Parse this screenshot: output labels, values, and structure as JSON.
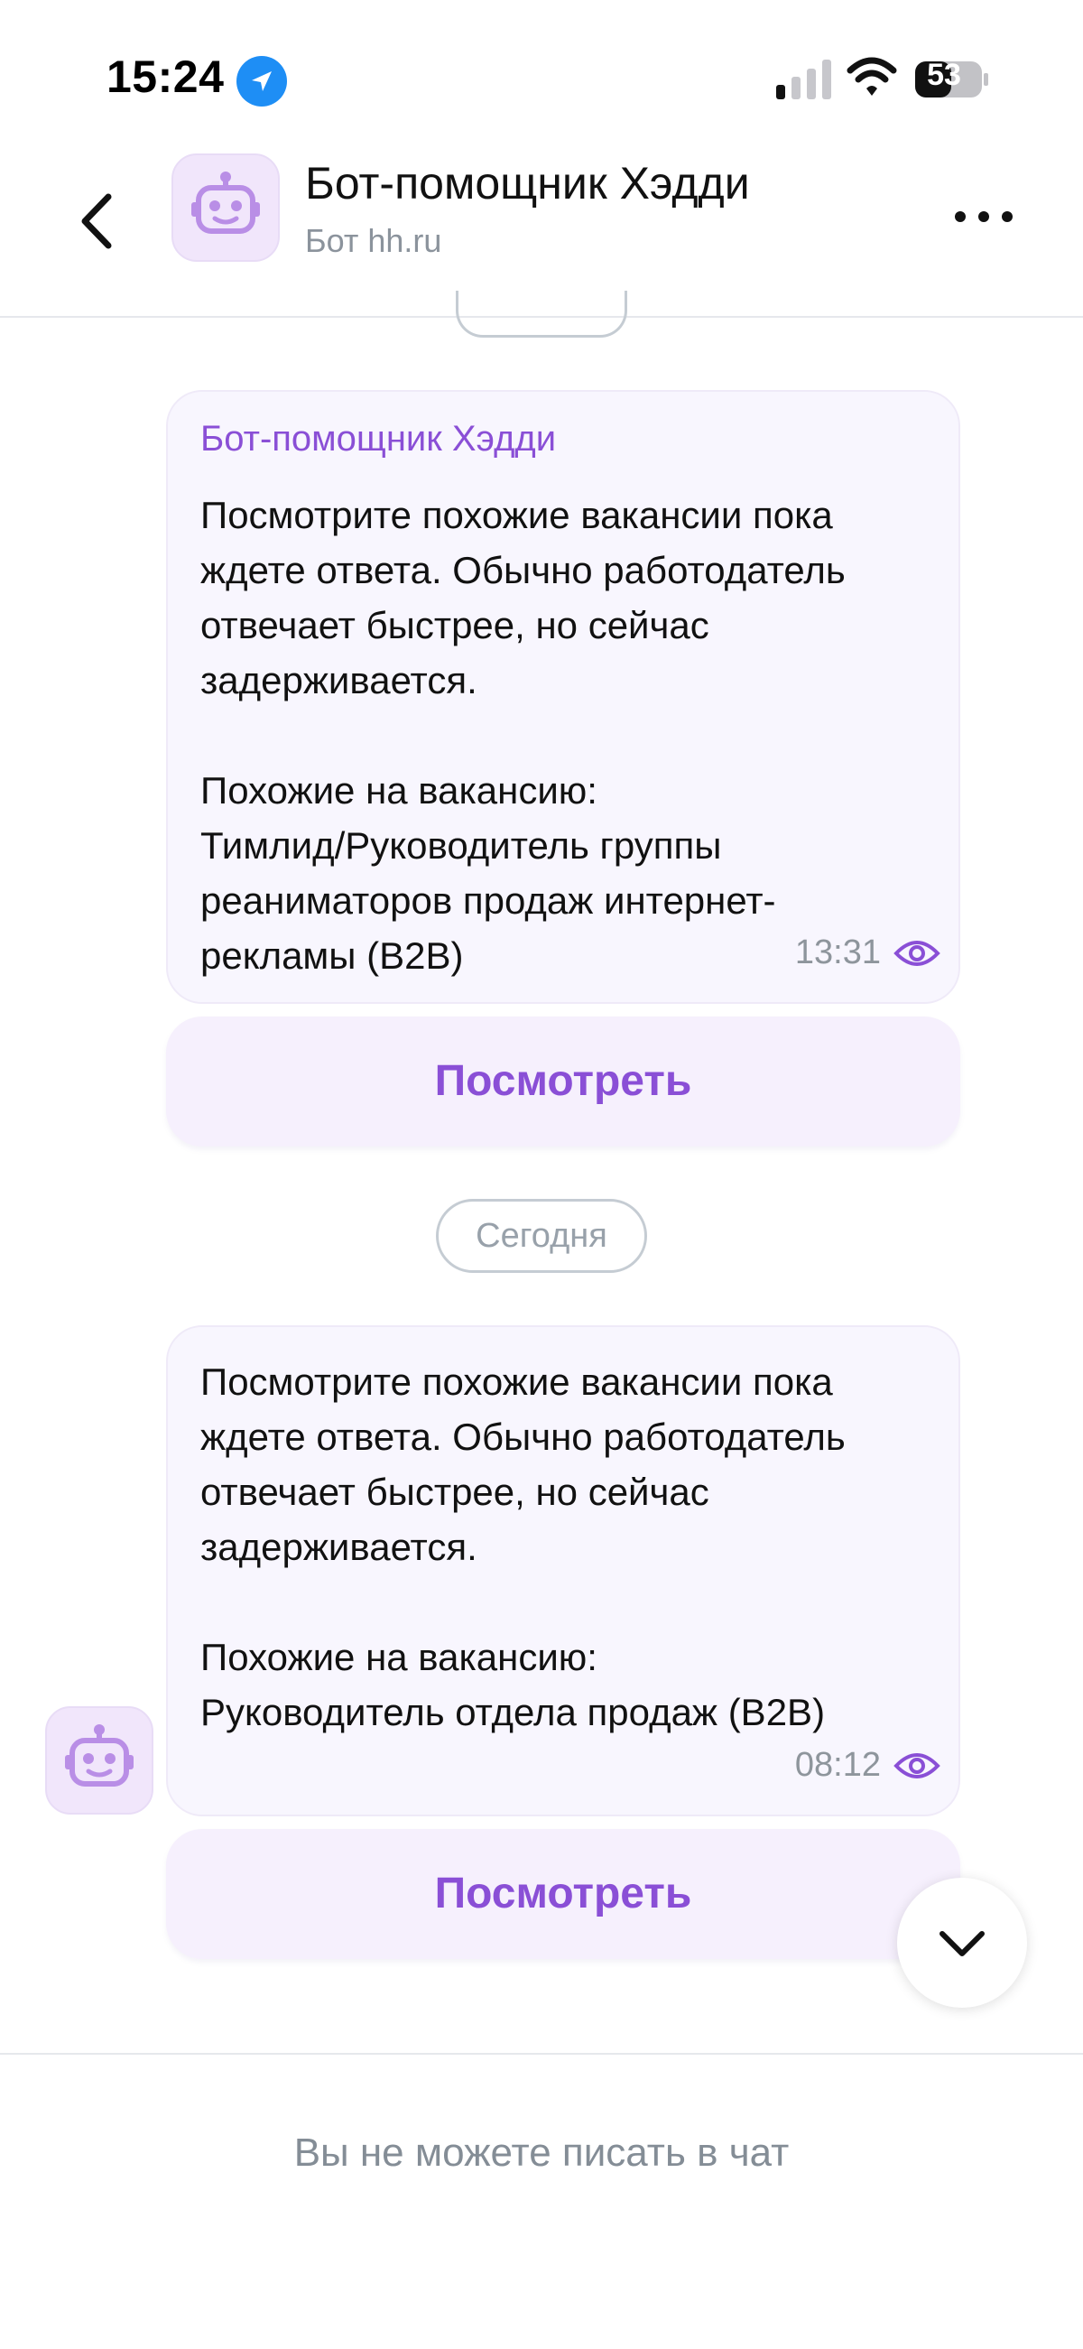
{
  "status_bar": {
    "time": "15:24",
    "battery": "53",
    "icons": [
      "location-arrow-icon",
      "cellular-signal-icon",
      "wifi-icon",
      "battery-icon"
    ]
  },
  "header": {
    "title": "Бот-помощник Хэдди",
    "subtitle": "Бот hh.ru",
    "icons": [
      "back-chevron-icon",
      "robot-avatar-icon",
      "more-dots-icon"
    ]
  },
  "messages": [
    {
      "sender": "Бот-помощник Хэдди",
      "text": "Посмотрите похожие вакансии пока\nждете ответа. Обычно работодатель\nотвечает быстрее, но сейчас\nзадерживается.\n\nПохожие на вакансию:\nТимлид/Руководитель группы\nреаниматоров продаж интернет-\nрекламы (B2B)",
      "time": "13:31",
      "button": "Посмотреть"
    },
    {
      "text": "Посмотрите похожие вакансии пока\nждете ответа. Обычно работодатель\nотвечает быстрее, но сейчас\nзадерживается.\n\nПохожие на вакансию:\nРуководитель отдела продаж (B2B)",
      "time": "08:12",
      "button": "Посмотреть"
    }
  ],
  "date_separator": "Сегодня",
  "footer": {
    "text": "Вы не можете писать в чат"
  },
  "colors": {
    "accent": "#8a4fd6",
    "bubble": "#f8f6fe",
    "button_bg": "#f6f0fd",
    "muted": "#8e959c"
  }
}
